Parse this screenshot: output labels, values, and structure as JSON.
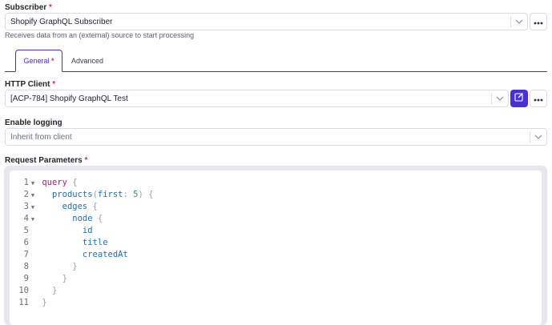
{
  "subscriber": {
    "label": "Subscriber",
    "required_mark": "*",
    "value": "Shopify GraphQL Subscriber",
    "help": "Receives data from an (external) source to start processing"
  },
  "tabs": [
    {
      "label": "General",
      "required_mark": "*",
      "active": true
    },
    {
      "label": "Advanced",
      "active": false
    }
  ],
  "http_client": {
    "label": "HTTP Client",
    "required_mark": "*",
    "value": "[ACP-784] Shopify GraphQL Test"
  },
  "logging": {
    "label": "Enable logging",
    "value": "Inherit from client"
  },
  "request_params": {
    "label": "Request Parameters",
    "required_mark": "*",
    "lines": [
      {
        "n": "1",
        "fold": "▼",
        "tokens": [
          {
            "t": "kw",
            "v": "query"
          },
          {
            "t": "p",
            "v": " {"
          }
        ]
      },
      {
        "n": "2",
        "fold": "▼",
        "tokens": [
          {
            "t": "p",
            "v": "  "
          },
          {
            "t": "fn",
            "v": "products"
          },
          {
            "t": "p",
            "v": "("
          },
          {
            "t": "fn",
            "v": "first"
          },
          {
            "t": "p",
            "v": ": "
          },
          {
            "t": "num",
            "v": "5"
          },
          {
            "t": "p",
            "v": ") {"
          }
        ]
      },
      {
        "n": "3",
        "fold": "▼",
        "tokens": [
          {
            "t": "p",
            "v": "    "
          },
          {
            "t": "fn",
            "v": "edges"
          },
          {
            "t": "p",
            "v": " {"
          }
        ]
      },
      {
        "n": "4",
        "fold": "▼",
        "tokens": [
          {
            "t": "p",
            "v": "      "
          },
          {
            "t": "fn",
            "v": "node"
          },
          {
            "t": "p",
            "v": " {"
          }
        ]
      },
      {
        "n": "5",
        "fold": "",
        "tokens": [
          {
            "t": "p",
            "v": "        "
          },
          {
            "t": "fn",
            "v": "id"
          }
        ]
      },
      {
        "n": "6",
        "fold": "",
        "tokens": [
          {
            "t": "p",
            "v": "        "
          },
          {
            "t": "fn",
            "v": "title"
          }
        ]
      },
      {
        "n": "7",
        "fold": "",
        "tokens": [
          {
            "t": "p",
            "v": "        "
          },
          {
            "t": "fn",
            "v": "createdAt"
          }
        ]
      },
      {
        "n": "8",
        "fold": "",
        "tokens": [
          {
            "t": "p",
            "v": "      }"
          }
        ]
      },
      {
        "n": "9",
        "fold": "",
        "tokens": [
          {
            "t": "p",
            "v": "    }"
          }
        ]
      },
      {
        "n": "10",
        "fold": "",
        "tokens": [
          {
            "t": "p",
            "v": "  }"
          }
        ]
      },
      {
        "n": "11",
        "fold": "",
        "tokens": [
          {
            "t": "p",
            "v": "}"
          }
        ]
      }
    ]
  },
  "icons": {
    "chevron": "chevron-down-icon",
    "more": "more-horizontal-icon",
    "edit": "edit-icon"
  },
  "colors": {
    "accent": "#4b2fd6",
    "required": "#e0245e",
    "keyword": "#b4187a",
    "identifier": "#1a6fbf",
    "number": "#2a9a6a"
  }
}
